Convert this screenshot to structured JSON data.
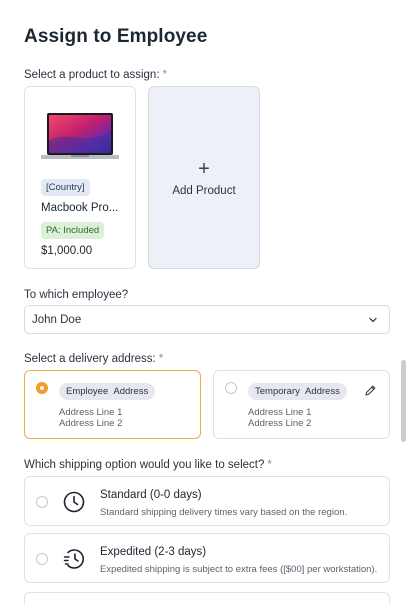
{
  "page": {
    "title": "Assign to Employee"
  },
  "product_section": {
    "label": "Select a product to assign:",
    "required_mark": "*",
    "product": {
      "country_badge": "[Country]",
      "name": "Macbook Pro...",
      "pa_badge": "PA: Included",
      "price": "$1,000.00"
    },
    "add_card": {
      "plus": "+",
      "label": "Add Product"
    }
  },
  "employee_section": {
    "label": "To which employee?",
    "selected": "John Doe"
  },
  "address_section": {
    "label": "Select a delivery address:",
    "required_mark": "*",
    "options": [
      {
        "tag": "Employee  Address",
        "line1": "Address Line 1",
        "line2": "Address Line 2",
        "selected": true
      },
      {
        "tag": "Temporary  Address",
        "line1": "Address Line 1",
        "line2": "Address Line 2",
        "selected": false
      }
    ]
  },
  "shipping_section": {
    "label": "Which shipping option would you like to select?",
    "required_mark": "*",
    "options": [
      {
        "title": "Standard (0-0 days)",
        "description": "Standard shipping delivery times vary based on the region.",
        "icon": "clock-icon"
      },
      {
        "title": "Expedited (2-3 days)",
        "description": "Expedited shipping is subject to extra fees ([$00] per workstation).",
        "icon": "fast-clock-icon"
      }
    ]
  },
  "colors": {
    "accent": "#f39a2a",
    "add_card_bg": "#eef0f8",
    "country_badge_bg": "#e3e8f5",
    "pa_badge_bg": "#dcefd9"
  }
}
